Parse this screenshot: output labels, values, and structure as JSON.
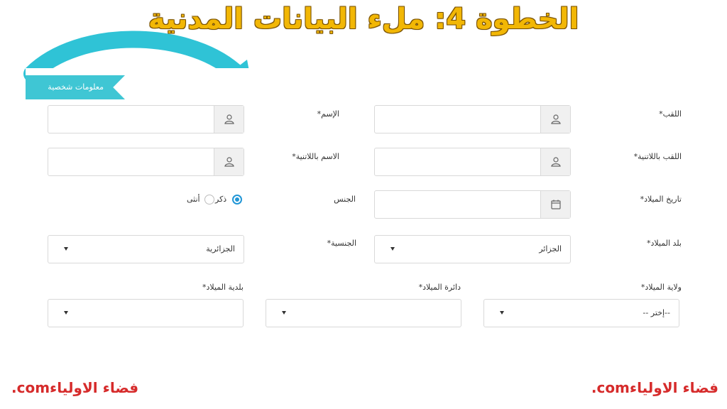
{
  "headline": "الخطوة 4: ملء البيانات المدنية",
  "section_ribbon": "معلومات شخصية",
  "fields": {
    "surname": {
      "label": "اللقب*",
      "value": ""
    },
    "first_name": {
      "label": "الإسم*",
      "value": ""
    },
    "surname_latin": {
      "label": "اللقب باللاتنية*",
      "value": ""
    },
    "first_name_latin": {
      "label": "الاسم باللاتنية*",
      "value": ""
    },
    "birth_date": {
      "label": "تاريخ الميلاد*",
      "value": ""
    },
    "gender": {
      "label": "الجنس",
      "options": [
        "ذكر",
        "أنثى"
      ],
      "selected": "ذكر"
    },
    "birth_country": {
      "label": "بلد الميلاد*",
      "value": "الجزائر"
    },
    "nationality": {
      "label": "الجنسية*",
      "value": "الجزائرية"
    },
    "birth_wilaya": {
      "label": "ولاية الميلاد*",
      "value": "--إختر --"
    },
    "birth_daira": {
      "label": "دائرة الميلاد*",
      "value": ""
    },
    "birth_commune": {
      "label": "بلدية الميلاد*",
      "value": ""
    }
  },
  "footer": {
    "left": ".comفضاء الاولياء",
    "right": ".comفضاء الاولياء"
  },
  "colors": {
    "headline": "#f2b705",
    "ribbon": "#3fc6d4",
    "arrow": "#2fc3d6",
    "radio_selected": "#2196d6",
    "footer": "#d62b2b"
  }
}
